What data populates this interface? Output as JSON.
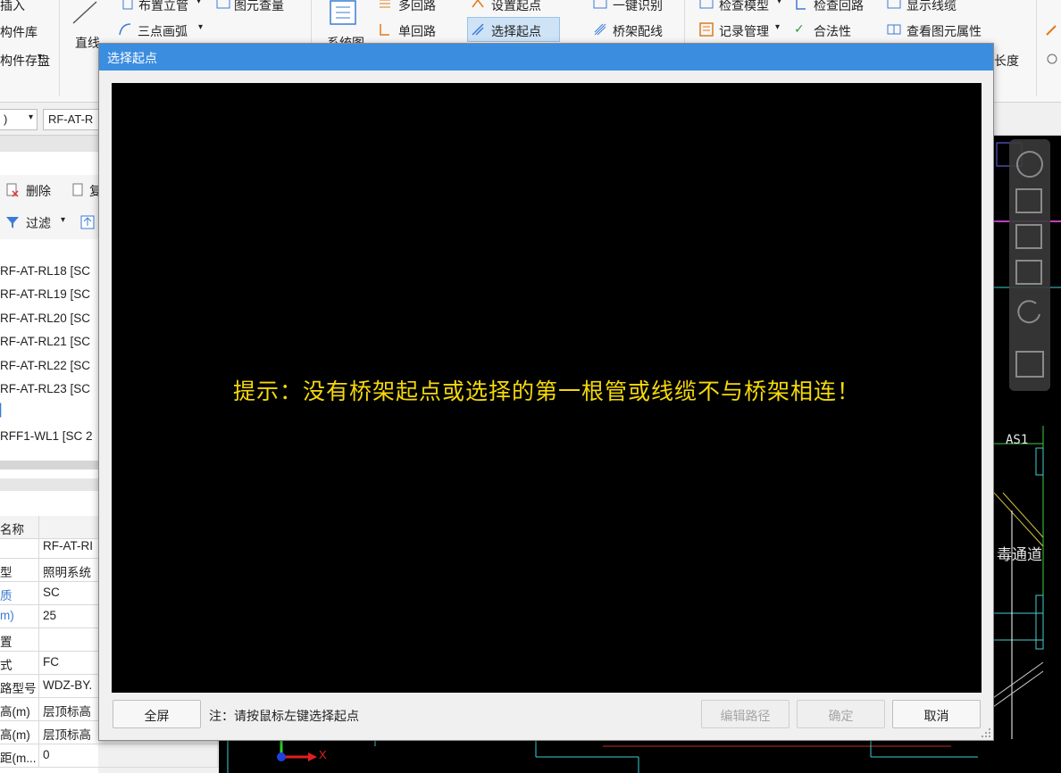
{
  "ribbon": {
    "items": {
      "insert": "插入",
      "component_lib": "构件库",
      "component_save": "构件存盘",
      "line": "直线",
      "arrange_riser": "布置立管",
      "three_point_arc": "三点画弧",
      "element_query": "图元查量",
      "system_diagram": "系统图",
      "multi_circuit": "多回路",
      "single_circuit": "单回路",
      "set_start": "设置起点",
      "select_start": "选择起点",
      "one_key_identify": "一键识别",
      "tray_wiring": "桥架配线",
      "check_model": "检查模型",
      "record_mgmt": "记录管理",
      "check_circuit": "检查回路",
      "legality": "合法性",
      "show_cable": "显示线缆",
      "view_element_props": "查看图元属性",
      "length": "长度"
    }
  },
  "toolbar2": {
    "combo1_value": ")",
    "combo2_value": "RF-AT-R"
  },
  "left_panel": {
    "delete_label": "删除",
    "copy_label": "复",
    "filter_label": "过滤",
    "tree_items": [
      "RF-AT-RL18 [SC",
      "RF-AT-RL19 [SC",
      "RF-AT-RL20 [SC",
      "RF-AT-RL21 [SC",
      "RF-AT-RL22 [SC",
      "RF-AT-RL23 [SC",
      "RFF1-WL1 [SC 2"
    ],
    "props_header": "名称",
    "props": [
      {
        "k": "",
        "v": "RF-AT-RI"
      },
      {
        "k": "型",
        "v": "照明系统"
      },
      {
        "k": "质",
        "v": "SC"
      },
      {
        "k": "m)",
        "v": "25"
      },
      {
        "k": "置",
        "v": ""
      },
      {
        "k": "式",
        "v": "FC"
      },
      {
        "k": "路型号",
        "v": "WDZ-BY."
      },
      {
        "k": "高(m)",
        "v": "层顶标高"
      },
      {
        "k": "高(m)",
        "v": "层顶标高"
      },
      {
        "k": "距(m...",
        "v": "0"
      }
    ]
  },
  "cad": {
    "label_as1": "AS1",
    "label_channel": "毒通道",
    "axis_x": "X"
  },
  "dialog": {
    "title": "选择起点",
    "hint": "提示：没有桥架起点或选择的第一根管或线缆不与桥架相连！",
    "note": "注：请按鼠标左键选择起点",
    "buttons": {
      "fullscreen": "全屏",
      "edit_path": "编辑路径",
      "ok": "确定",
      "cancel": "取消"
    }
  },
  "colors": {
    "title_bar": "#3b8de0",
    "hint_text": "#f5d90a",
    "canvas": "#000000"
  }
}
